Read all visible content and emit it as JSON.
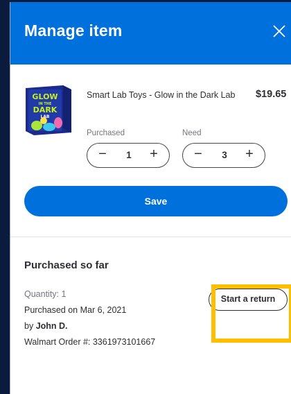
{
  "header": {
    "title": "Manage item",
    "close_icon": "close-icon"
  },
  "product": {
    "name": "Smart Lab Toys - Glow in the Dark Lab",
    "price": "$19.65",
    "image": {
      "icon": "product-box-image",
      "text_line1": "GLOW",
      "text_line2": "IN THE",
      "text_line3": "DARK",
      "text_line4": "LAB"
    },
    "purchased": {
      "label": "Purchased",
      "value": "1",
      "minus": "−",
      "plus": "+"
    },
    "need": {
      "label": "Need",
      "value": "3",
      "minus": "−",
      "plus": "+"
    }
  },
  "save_label": "Save",
  "purchases": {
    "title": "Purchased so far",
    "quantity_text": "Quantity: 1",
    "date_text": "Purchased on Mar 6, 2021",
    "by_prefix": "by ",
    "by_name": "John D.",
    "order_text": "Walmart Order #: 3361973101667",
    "return_label": "Start a return"
  },
  "colors": {
    "brand_blue": "#0071dc",
    "highlight": "#ffbe00",
    "text": "#2e2f32",
    "muted": "#74767c"
  }
}
